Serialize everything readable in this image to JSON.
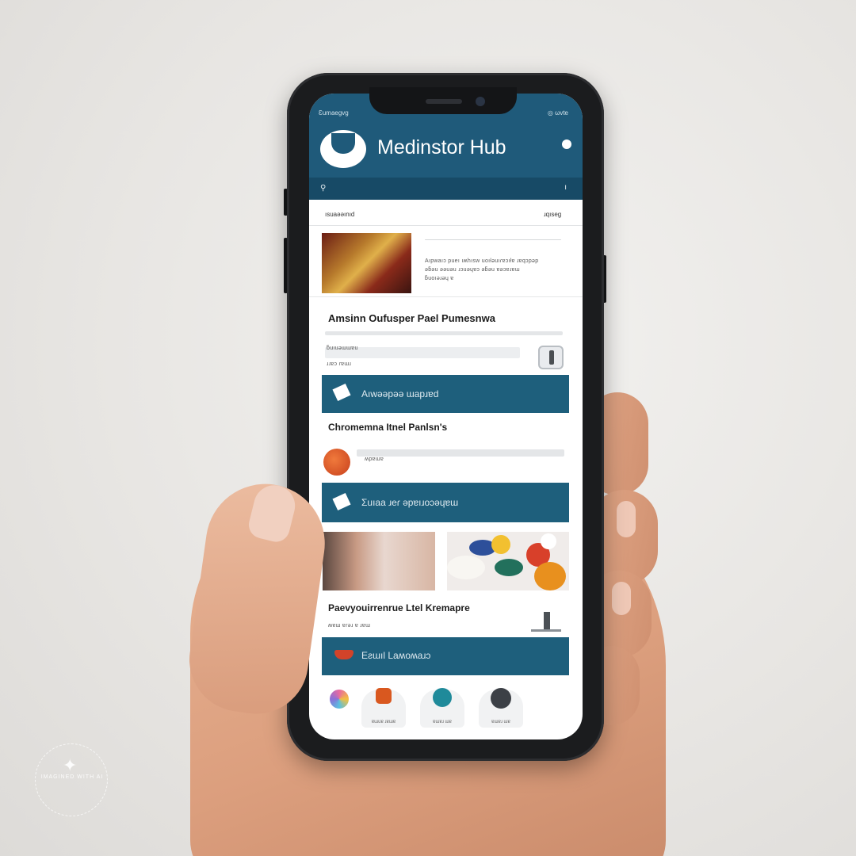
{
  "status_bar": {
    "left": "Ɛumaegvg",
    "right": "◎ ωvte"
  },
  "header": {
    "title": "Medinstor Hub",
    "logo_icon": "medical-cross-logo-icon"
  },
  "search": {
    "icon": "search-icon",
    "end_glyph": "ı"
  },
  "section_top": {
    "left_label": "ısuaəəınıd",
    "right_label": "ɹqıseg"
  },
  "hero_card": {
    "lines": [
      "Aıpwaıɔ pueı ıʍhısw uoıƚǝuıɾɐɔıƚɐ ɹɐqɔpǝp",
      "ǝƃǝu ǝǝuǝu ɹɔuǝɥɐɔ ǝƃǝu ɐǝɔɐɹɐɯ",
      "ƃuoıǝɹǝɥ ɐ"
    ]
  },
  "section_1": {
    "title": "Amsinn Oufusper Pael Pumesnwa",
    "lines": [
      "ƃuıuǝɯɯɐu",
      "ɹɹɐɔ ɾɐɯɹ"
    ]
  },
  "cta_1": {
    "label": "Aıwəəpəə ɯapɹɐd",
    "icon": "note-icon"
  },
  "section_2": {
    "title": "Chromemna Itnel Panlsn's",
    "line": "ʍpɐɯɐ"
  },
  "cta_2": {
    "label": "Ʃuıaa ɹeɾ ǝpɐıɹoɔǝɥɐɯ",
    "icon": "note-icon"
  },
  "section_3": {
    "title": "Paevyouirrenrue Ltel Kremapre",
    "line": "ʍɐɯ ɐɾǝɹ ɐ ɹɐɯ"
  },
  "cta_3": {
    "label": "Eƨɯıl Laʍoʍaɹɔ",
    "icon": "heart-pulse-icon"
  },
  "tabbar": [
    {
      "label": "",
      "icon": "color-wheel-icon",
      "color": "#c07ad0"
    },
    {
      "label": "ɐɯuɐ ɹɐɯɐ",
      "icon": "ticket-icon",
      "color": "#d9581f"
    },
    {
      "label": "ɐɯɐɹ ɯɐ",
      "icon": "chat-bubble-icon",
      "color": "#1f8a9a"
    },
    {
      "label": "ɐɯɐɹ ɯɐ",
      "icon": "record-icon",
      "color": "#3c4046"
    }
  ],
  "watermark": {
    "text": "IMAGINED WITH AI"
  },
  "colors": {
    "brand": "#1f5a7a",
    "button": "#1e5f7c",
    "background": "#ffffff"
  }
}
